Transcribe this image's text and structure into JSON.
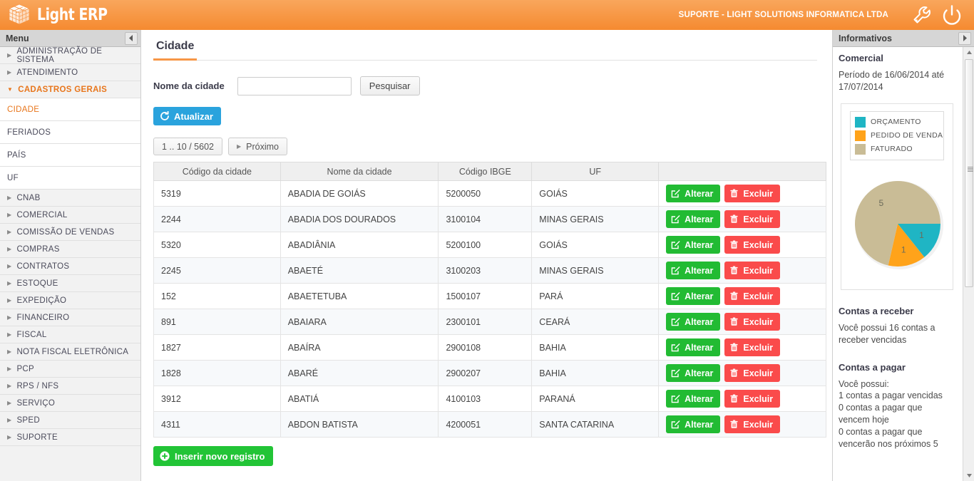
{
  "topbar": {
    "logo_text": "Light ERP",
    "company": "SUPORTE - LIGHT SOLUTIONS INFORMATICA LTDA",
    "icons": [
      "wrench-icon",
      "power-icon"
    ],
    "accent_color": "#f79646"
  },
  "sidebar": {
    "header": "Menu",
    "collapse_label": "◄",
    "groups": [
      {
        "label": "ADMINISTRAÇÃO DE SISTEMA",
        "open": false
      },
      {
        "label": "ATENDIMENTO",
        "open": false
      },
      {
        "label": "CADASTROS GERAIS",
        "open": true
      }
    ],
    "sub_items": [
      {
        "label": "CIDADE",
        "active": true
      },
      {
        "label": "FERIADOS",
        "active": false
      },
      {
        "label": "PAÍS",
        "active": false
      },
      {
        "label": "UF",
        "active": false
      }
    ],
    "groups2": [
      {
        "label": "CNAB"
      },
      {
        "label": "COMERCIAL"
      },
      {
        "label": "COMISSÃO DE VENDAS"
      },
      {
        "label": "COMPRAS"
      },
      {
        "label": "CONTRATOS"
      },
      {
        "label": "ESTOQUE"
      },
      {
        "label": "EXPEDIÇÃO"
      },
      {
        "label": "FINANCEIRO"
      },
      {
        "label": "FISCAL"
      },
      {
        "label": "NOTA FISCAL ELETRÔNICA"
      },
      {
        "label": "PCP"
      },
      {
        "label": "RPS / NFS"
      },
      {
        "label": "SERVIÇO"
      },
      {
        "label": "SPED"
      },
      {
        "label": "SUPORTE"
      }
    ]
  },
  "main": {
    "page_title": "Cidade",
    "search": {
      "label": "Nome da cidade",
      "value": "",
      "placeholder": "",
      "button": "Pesquisar"
    },
    "refresh_button": "Atualizar",
    "pager": {
      "range": "1 .. 10 / 5602",
      "next": "Próximo"
    },
    "table": {
      "columns": [
        "Código da cidade",
        "Nome da cidade",
        "Código IBGE",
        "UF",
        ""
      ],
      "rows": [
        {
          "codigo": "5319",
          "nome": "ABADIA DE GOIÁS",
          "ibge": "5200050",
          "uf": "GOIÁS"
        },
        {
          "codigo": "2244",
          "nome": "ABADIA DOS DOURADOS",
          "ibge": "3100104",
          "uf": "MINAS GERAIS"
        },
        {
          "codigo": "5320",
          "nome": "ABADIÂNIA",
          "ibge": "5200100",
          "uf": "GOIÁS"
        },
        {
          "codigo": "2245",
          "nome": "ABAETÉ",
          "ibge": "3100203",
          "uf": "MINAS GERAIS"
        },
        {
          "codigo": "152",
          "nome": "ABAETETUBA",
          "ibge": "1500107",
          "uf": "PARÁ"
        },
        {
          "codigo": "891",
          "nome": "ABAIARA",
          "ibge": "2300101",
          "uf": "CEARÁ"
        },
        {
          "codigo": "1827",
          "nome": "ABAÍRA",
          "ibge": "2900108",
          "uf": "BAHIA"
        },
        {
          "codigo": "1828",
          "nome": "ABARÉ",
          "ibge": "2900207",
          "uf": "BAHIA"
        },
        {
          "codigo": "3912",
          "nome": "ABATIÁ",
          "ibge": "4100103",
          "uf": "PARANÁ"
        },
        {
          "codigo": "4311",
          "nome": "ABDON BATISTA",
          "ibge": "4200051",
          "uf": "SANTA CATARINA"
        }
      ],
      "edit_label": "Alterar",
      "delete_label": "Excluir"
    },
    "insert_button": "Inserir novo registro"
  },
  "info": {
    "header": "Informativos",
    "expand_label": "►",
    "section_title": "Comercial",
    "period": "Período de 16/06/2014 até 17/07/2014",
    "receivable_title": "Contas a receber",
    "receivable_text": "Você possui 16 contas a receber vencidas",
    "payable_title": "Contas a pagar",
    "payable_text": "Você possui:\n  1 contas a pagar vencidas\n  0 contas a pagar que vencem hoje\n  0 contas a pagar que vencerão nos próximos 5"
  },
  "chart_data": {
    "type": "pie",
    "title": "Comercial",
    "subtitle": "Período de 16/06/2014 até 17/07/2014",
    "categories": [
      "ORÇAMENTO",
      "PEDIDO DE VENDA",
      "FATURADO"
    ],
    "values": [
      1,
      1,
      5
    ],
    "colors": [
      "#1fb5c4",
      "#ffa31a",
      "#c9bc96"
    ],
    "labels": [
      "1",
      "1",
      "5"
    ],
    "legend_position": "top",
    "grid": false
  }
}
